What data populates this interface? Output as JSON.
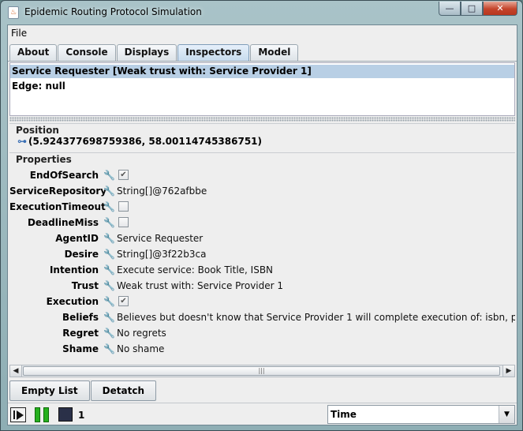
{
  "window": {
    "title": "Epidemic Routing Protocol Simulation",
    "app_icon_glyph": "♨",
    "controls": {
      "minimize": "—",
      "maximize": "□",
      "close": "✕"
    }
  },
  "menu": {
    "file": "File"
  },
  "tabs": [
    {
      "label": "About",
      "active": false
    },
    {
      "label": "Console",
      "active": false
    },
    {
      "label": "Displays",
      "active": false
    },
    {
      "label": "Inspectors",
      "active": true
    },
    {
      "label": "Model",
      "active": false
    }
  ],
  "inspector": {
    "selected": "Service Requester [Weak trust with: Service Provider 1]",
    "edge": "Edge: null"
  },
  "position": {
    "title": "Position",
    "glyph": "⊶",
    "value": "(5.924377698759386, 58.00114745386751)"
  },
  "properties": {
    "title": "Properties",
    "wrench_glyph": "🔧",
    "items": [
      {
        "label": "EndOfSearch",
        "type": "checkbox",
        "checked": true,
        "value": "✔"
      },
      {
        "label": "ServiceRepository",
        "type": "text",
        "value": "String[]@762afbbe"
      },
      {
        "label": "ExecutionTimeout",
        "type": "checkbox",
        "checked": false,
        "value": ""
      },
      {
        "label": "DeadlineMiss",
        "type": "checkbox",
        "checked": false,
        "value": ""
      },
      {
        "label": "AgentID",
        "type": "text",
        "value": "Service Requester"
      },
      {
        "label": "Desire",
        "type": "text",
        "value": "String[]@3f22b3ca"
      },
      {
        "label": "Intention",
        "type": "text",
        "value": "Execute service: Book Title, ISBN"
      },
      {
        "label": "Trust",
        "type": "text",
        "value": "Weak trust with: Service Provider 1"
      },
      {
        "label": "Execution",
        "type": "checkbox",
        "checked": true,
        "value": "✔"
      },
      {
        "label": "Beliefs",
        "type": "text",
        "value": "Believes but doesn't know that Service Provider 1 will complete execution of: isbn, price usd"
      },
      {
        "label": "Regret",
        "type": "text",
        "value": "No regrets"
      },
      {
        "label": "Shame",
        "type": "text",
        "value": "No shame"
      }
    ]
  },
  "scrollbar": {
    "left_glyph": "◀",
    "right_glyph": "▶",
    "thumb_glyph": "|||"
  },
  "buttons": {
    "empty_list": "Empty List",
    "detatch": "Detatch"
  },
  "sim_controls": {
    "steps": "1",
    "time_label": "Time",
    "dropdown_glyph": "▼"
  },
  "colors": {
    "selection": "#b8cfe5",
    "pause_green": "#26b01e",
    "stop_navy": "#2a3048"
  }
}
